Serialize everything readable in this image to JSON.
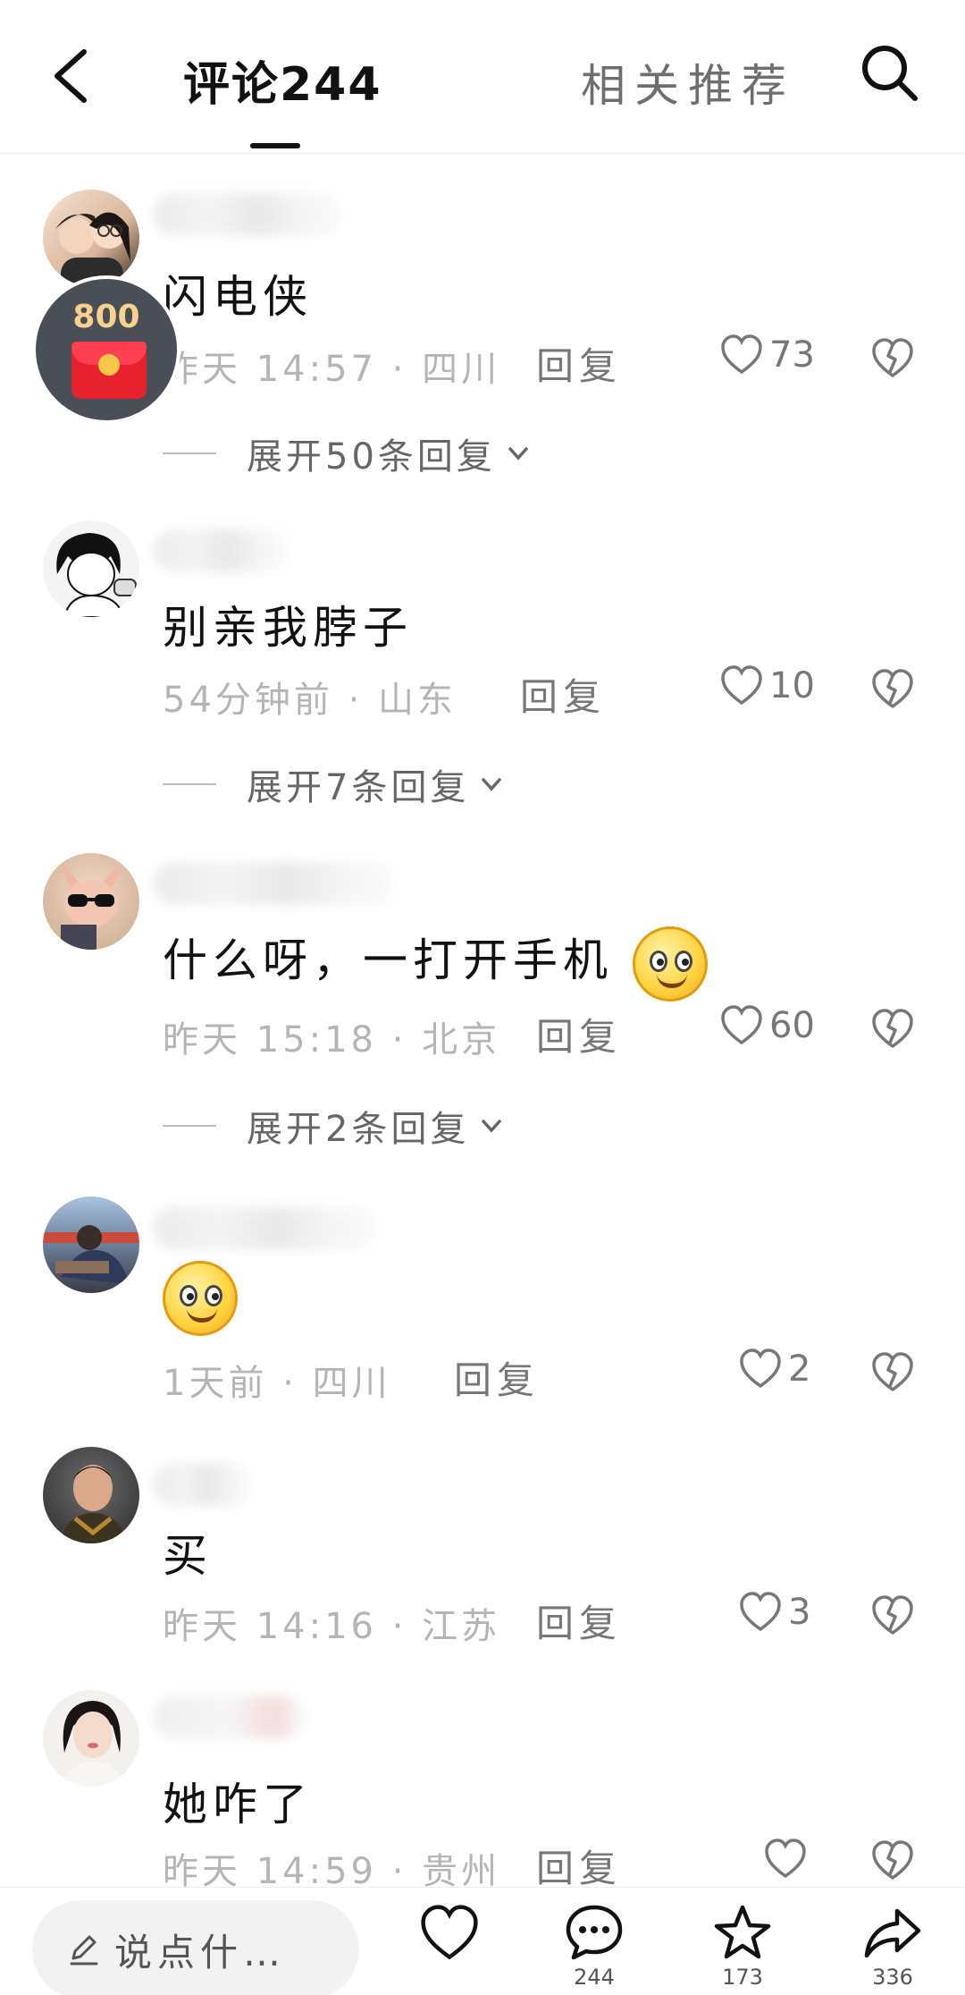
{
  "header": {
    "back_icon": "back-arrow-icon",
    "tab_comments": "评论244",
    "tab_related": "相关推荐",
    "search_icon": "search-icon"
  },
  "red_packet": {
    "amount": "800"
  },
  "comments": [
    {
      "text": "闪电侠",
      "meta": "昨天 14:57 · 四川",
      "reply": "回复",
      "likes": "73",
      "expand": "展开50条回复"
    },
    {
      "text": "别亲我脖子",
      "meta": "54分钟前 · 山东",
      "reply": "回复",
      "likes": "10",
      "expand": "展开7条回复"
    },
    {
      "text": "什么呀，一打开手机",
      "meta": "昨天 15:18 · 北京",
      "reply": "回复",
      "likes": "60",
      "expand": "展开2条回复"
    },
    {
      "text": "",
      "meta": "1天前 · 四川",
      "reply": "回复",
      "likes": "2"
    },
    {
      "text": "买",
      "meta": "昨天 14:16 · 江苏",
      "reply": "回复",
      "likes": "3"
    },
    {
      "text": "她咋了",
      "meta": "昨天 14:59 · 贵州",
      "reply": "回复",
      "likes": ""
    }
  ],
  "bottom": {
    "input_placeholder": "说点什…",
    "comment_count": "244",
    "favorite_count": "173",
    "share_count": "336"
  }
}
